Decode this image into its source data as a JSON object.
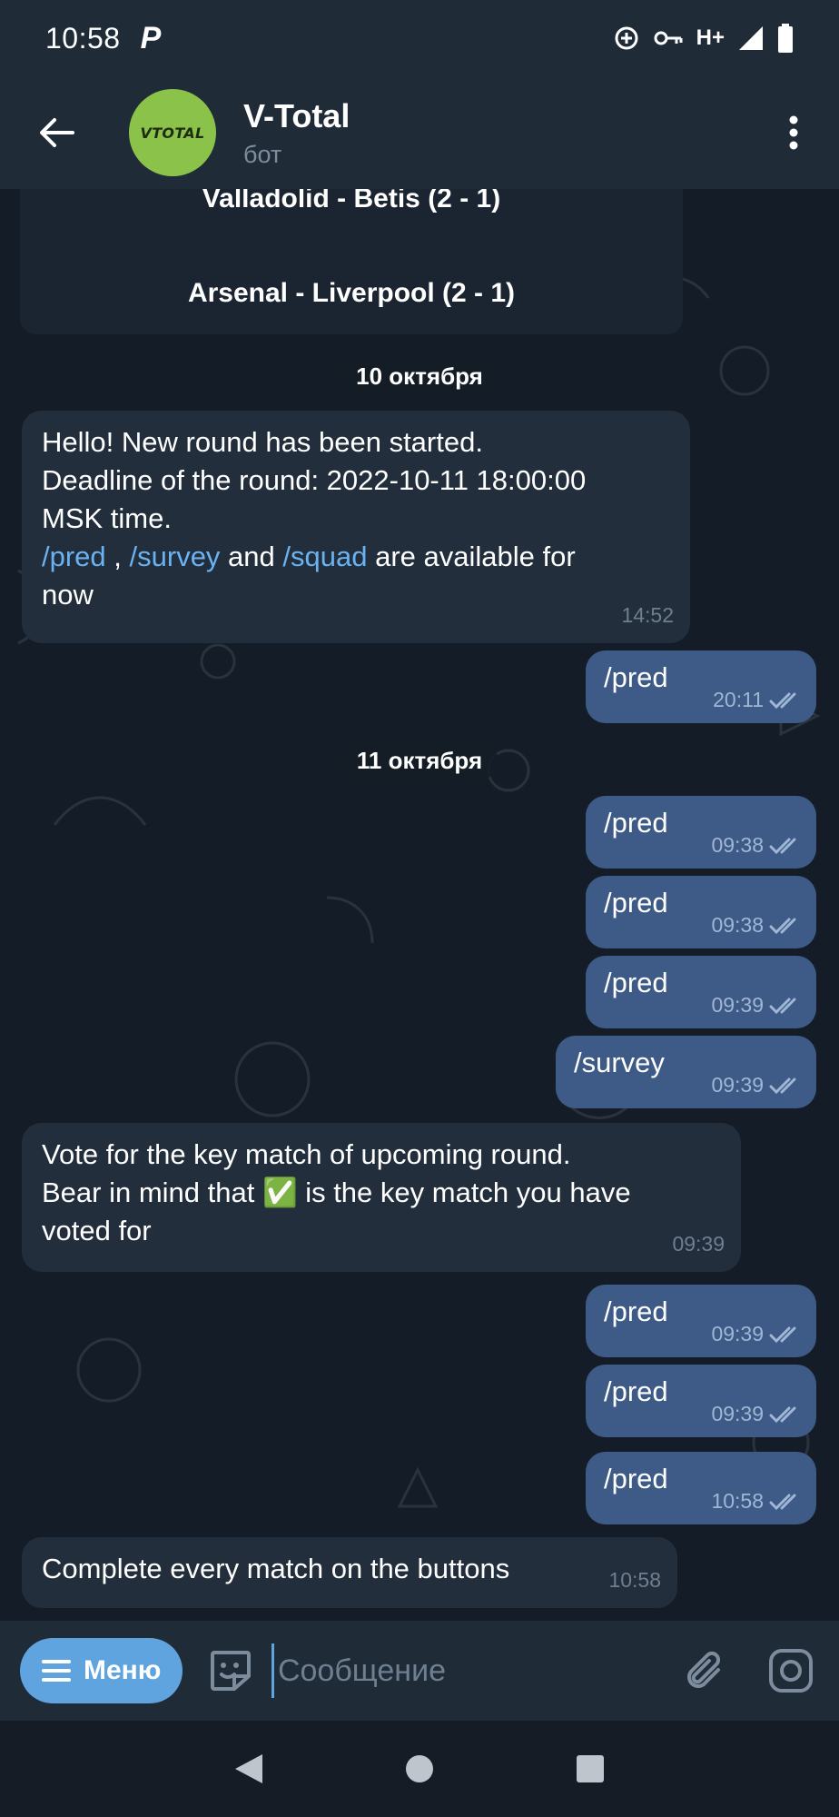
{
  "status_bar": {
    "time": "10:58",
    "left_icon": "P",
    "network": "H+"
  },
  "header": {
    "title": "V-Total",
    "subtitle": "бот",
    "avatar_text": "VTOTAL"
  },
  "chat": {
    "prev_matches": [
      "Valladolid - Betis (2 - 1)",
      "Arsenal - Liverpool (2 - 1)"
    ],
    "date_1": "10 октября",
    "date_2": "11 октября",
    "msg1": {
      "line1": "Hello! New round has been started.",
      "line2": "Deadline of the round: 2022-10-11 18:00:00",
      "line3": "MSK time.",
      "cmd_pred": "/pred",
      "sep1": " , ",
      "cmd_survey": "/survey",
      "sep2": " and ",
      "cmd_squad": "/squad",
      "tail": " are available for",
      "line5": "now",
      "time": "14:52"
    },
    "out1": {
      "text": "/pred",
      "time": "20:11"
    },
    "out2": {
      "text": "/pred",
      "time": "09:38"
    },
    "out3": {
      "text": "/pred",
      "time": "09:38"
    },
    "out4": {
      "text": "/pred",
      "time": "09:39"
    },
    "out5": {
      "text": "/survey",
      "time": "09:39"
    },
    "msg2": {
      "line1": "Vote for the key match of upcoming round.",
      "line2_a": "Bear in mind that ",
      "check": "✅",
      "line2_b": " is the key match you have",
      "line3": "voted for",
      "time": "09:39"
    },
    "out6": {
      "text": "/pred",
      "time": "09:39"
    },
    "out7": {
      "text": "/pred",
      "time": "09:39"
    },
    "out8": {
      "text": "/pred",
      "time": "10:58"
    },
    "msg3": {
      "text": "Complete every match on the buttons",
      "time": "10:58"
    }
  },
  "composer": {
    "menu_label": "Меню",
    "placeholder": "Сообщение"
  },
  "colors": {
    "background": "#141d27",
    "bar": "#202b38",
    "incoming_bubble": "#222e3b",
    "outgoing_bubble": "#3e5a87",
    "link": "#6ab2f2",
    "menu_button": "#5fa3df",
    "avatar": "#8bc34a"
  },
  "icons": [
    "back-arrow-icon",
    "more-vertical-icon",
    "double-check-icon",
    "sticker-icon",
    "paperclip-icon",
    "camera-icon",
    "nav-back-icon",
    "nav-home-icon",
    "nav-recents-icon"
  ]
}
